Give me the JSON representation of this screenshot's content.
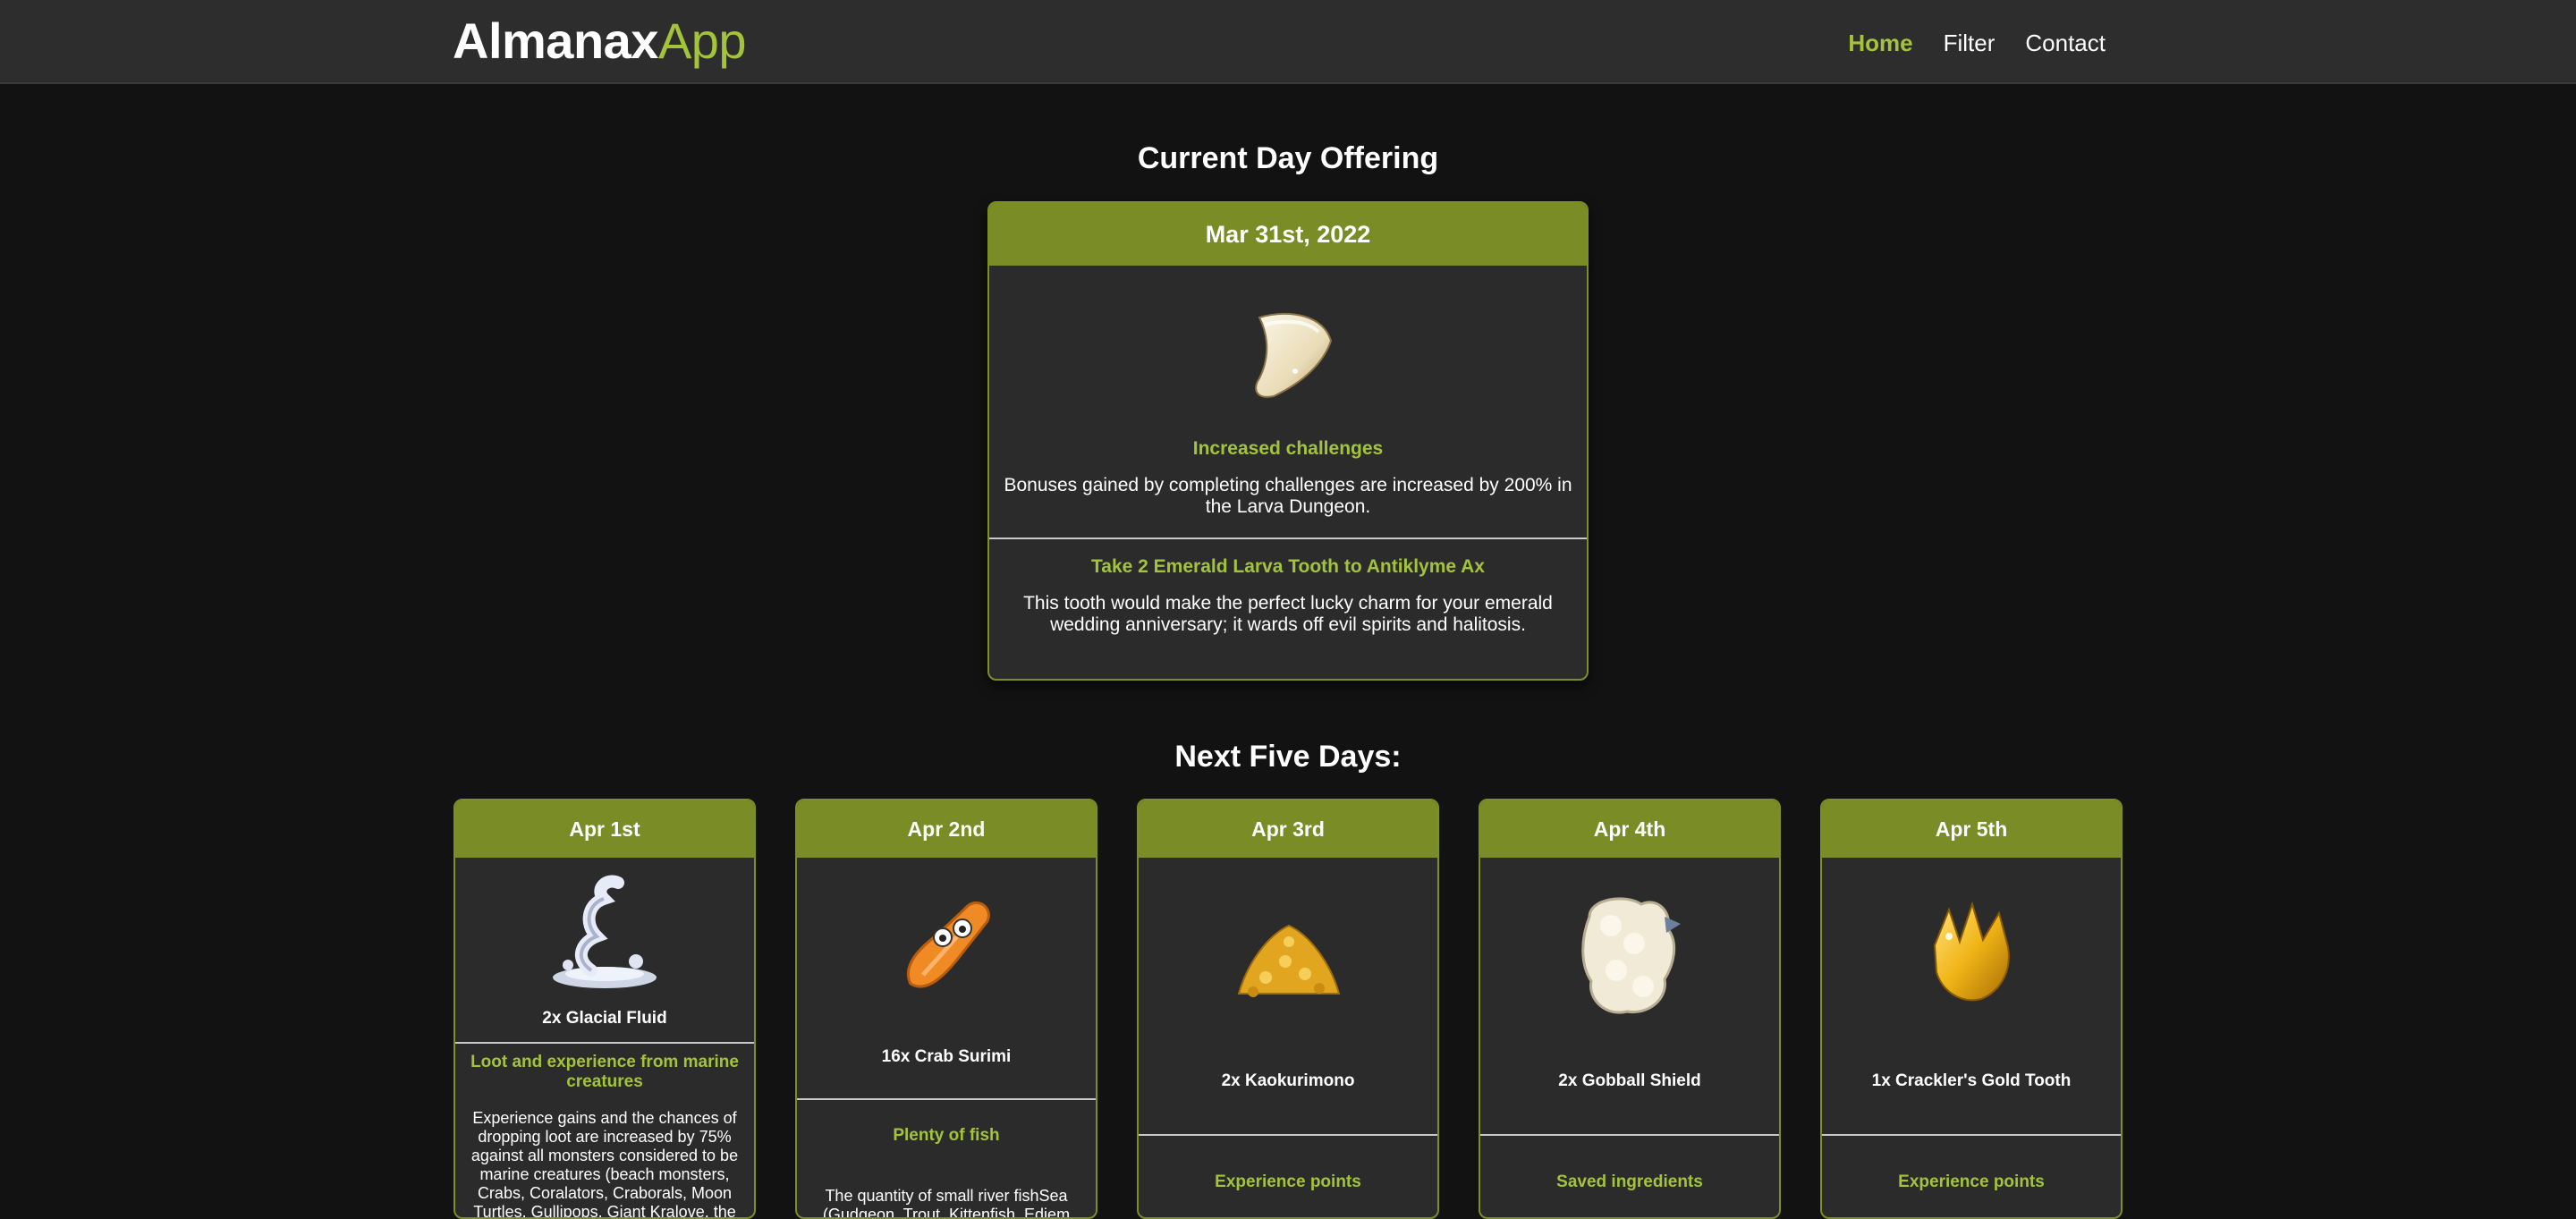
{
  "nav": {
    "brand_main": "Almanax",
    "brand_accent": "App",
    "links": [
      "Home",
      "Filter",
      "Contact"
    ]
  },
  "current": {
    "section_title": "Current Day Offering",
    "date": "Mar 31st, 2022",
    "bonus_title": "Increased challenges",
    "bonus_desc": "Bonuses gained by completing challenges are increased by 200% in the Larva Dungeon.",
    "quest_title": "Take 2 Emerald Larva Tooth to Antiklyme Ax",
    "quest_desc": "This tooth would make the perfect lucky charm for your emerald wedding anniversary; it wards off evil spirits and halitosis.",
    "icon": "tooth-icon"
  },
  "next": {
    "section_title": "Next Five Days:",
    "days": [
      {
        "date": "Apr 1st",
        "item": "2x Glacial Fluid",
        "icon": "glacial-fluid-icon",
        "bonus_title": "Loot and experience from marine creatures",
        "bonus_desc": "Experience gains and the chances of dropping loot are increased by 75% against all monsters considered to be marine creatures (beach monsters, Crabs, Coralators, Craborals, Moon Turtles, Gullipops, Giant Kralove, the"
      },
      {
        "date": "Apr 2nd",
        "item": "16x Crab Surimi",
        "icon": "crab-surimi-icon",
        "bonus_title": "Plenty of fish",
        "bonus_desc": "The quantity of small river fishSea (Gudgeon, Trout, Kittenfish, Ediem Carp)"
      },
      {
        "date": "Apr 3rd",
        "item": "2x Kaokurimono",
        "icon": "kaokurimono-icon",
        "bonus_title": "Experience points",
        "bonus_desc": ""
      },
      {
        "date": "Apr 4th",
        "item": "2x Gobball Shield",
        "icon": "gobball-shield-icon",
        "bonus_title": "Saved ingredients",
        "bonus_desc": ""
      },
      {
        "date": "Apr 5th",
        "item": "1x Crackler's Gold Tooth",
        "icon": "crackler-gold-tooth-icon",
        "bonus_title": "Experience points",
        "bonus_desc": ""
      }
    ]
  },
  "colors": {
    "accent": "#a3c43a",
    "card_header": "#7a8c26",
    "navbar": "#2d2d2d",
    "background": "#121212",
    "card": "#2b2b2b"
  }
}
